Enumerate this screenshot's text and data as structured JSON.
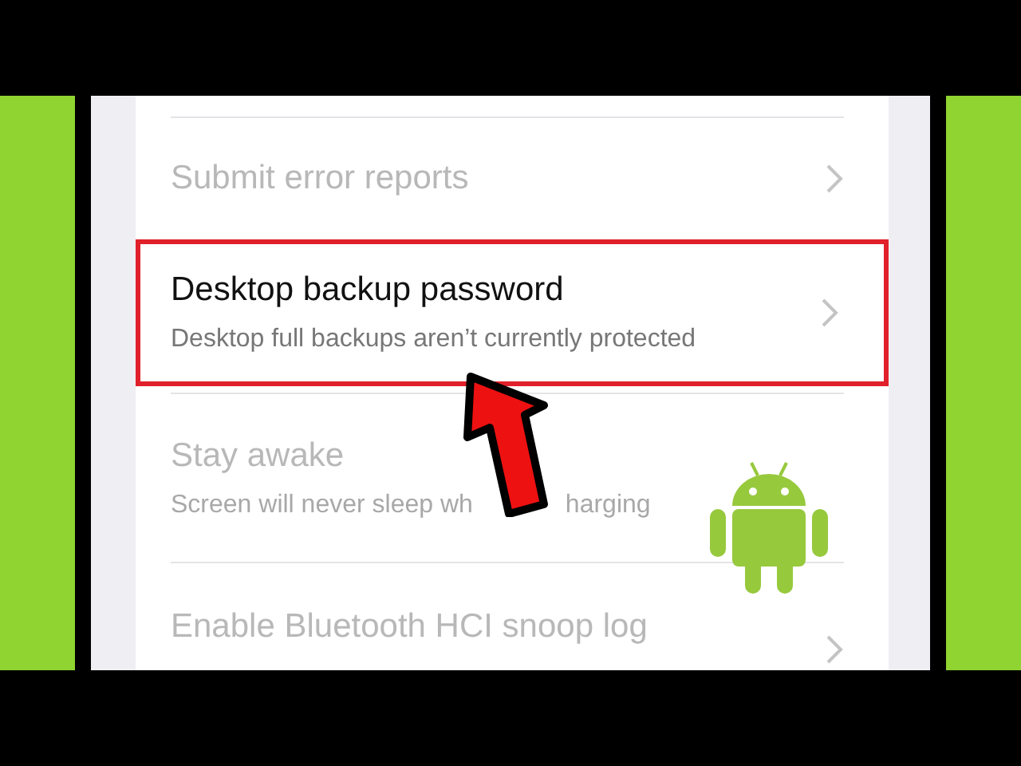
{
  "settings": [
    {
      "title": "Submit error reports",
      "disabled": true,
      "highlighted": false,
      "chevron": true
    },
    {
      "title": "Desktop backup password",
      "subtitle": "Desktop full backups aren’t currently protected",
      "disabled": false,
      "highlighted": true,
      "chevron": true
    },
    {
      "title": "Stay awake",
      "subtitle_parts": [
        "Screen will never sleep wh",
        "harging"
      ],
      "disabled": true,
      "highlighted": false,
      "chevron": false
    },
    {
      "title": "Enable Bluetooth HCI snoop log",
      "disabled": true,
      "highlighted": false,
      "chevron": true
    }
  ]
}
